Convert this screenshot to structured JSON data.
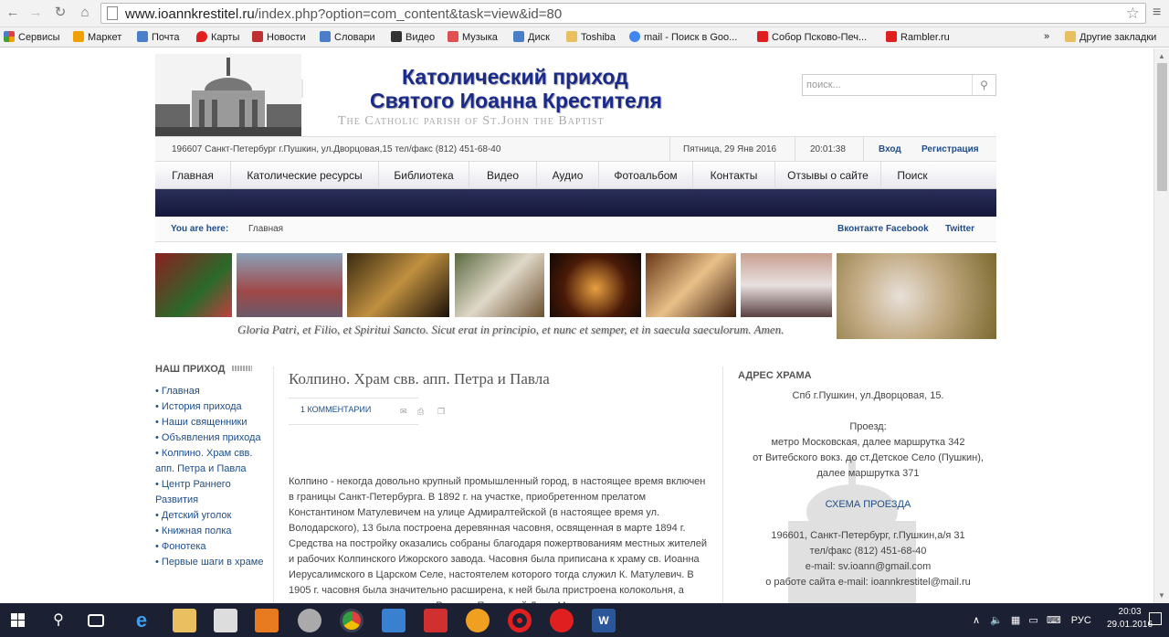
{
  "browser": {
    "url_host": "www.ioannkrestitel.ru",
    "url_path": "/index.php?option=com_content&task=view&id=80"
  },
  "bookmarks": [
    {
      "label": "Сервисы",
      "color": "#e04040"
    },
    {
      "label": "Маркет",
      "color": "#f0a000"
    },
    {
      "label": "Почта",
      "color": "#4a7ec8"
    },
    {
      "label": "Карты",
      "color": "#e02020"
    },
    {
      "label": "Новости",
      "color": "#c03030"
    },
    {
      "label": "Словари",
      "color": "#4a7ec8"
    },
    {
      "label": "Видео",
      "color": "#333333"
    },
    {
      "label": "Музыка",
      "color": "#e05050"
    },
    {
      "label": "Диск",
      "color": "#4a7ec8"
    },
    {
      "label": "Toshiba",
      "color": "#e8c060"
    },
    {
      "label": "mail - Поиск в Goo...",
      "color": "#4285f4"
    },
    {
      "label": "Собор Псково-Печ...",
      "color": "#e02020"
    },
    {
      "label": "Rambler.ru",
      "color": "#e02020"
    }
  ],
  "bookmarks_more": "»",
  "bookmarks_other": "Другие закладки",
  "site": {
    "title_line1": "Католический приход",
    "title_line2": "Святого Иоанна Крестителя",
    "title_en": "The Catholic parish of St.John the Baptist",
    "search_placeholder": "поиск...",
    "address": "196607 Санкт-Петербург г.Пушкин, ул.Дворцовая,15 тел/факс (812) 451-68-40",
    "date": "Пятница, 29 Янв 2016",
    "time": "20:01:38",
    "login": "Вход",
    "register": "Регистрация"
  },
  "nav": [
    "Главная",
    "Католические ресурсы",
    "Библиотека",
    "Видео",
    "Аудио",
    "Фотоальбом",
    "Контакты",
    "Отзывы о сайте",
    "Поиск"
  ],
  "breadcrumb": {
    "you_are_here": "You are here:",
    "current": "Главная",
    "social": "Вконтакте Facebook",
    "twitter": "Twitter"
  },
  "banner_motto": "Gloria Patri, et Filio, et Spiritui Sancto. Sicut erat in principio, et nunc et semper, et in saecula saeculorum. Amen.",
  "left": {
    "heading": "НАШ ПРИХОД",
    "items": [
      "• Главная",
      "• История прихода",
      "• Наши священники",
      "• Объявления прихода",
      "• Колпино. Храм свв. апп. Петра и Павла",
      "• Центр Раннего Развития",
      "• Детский уголок",
      "• Книжная полка",
      "• Фонотека",
      "• Первые шаги в храме"
    ]
  },
  "article": {
    "title": "Колпино. Храм свв. апп. Петра и Павла",
    "comments": "1 КОММЕНТАРИИ",
    "body": "Колпино - некогда довольно крупный промышленный город, в настоящее время включен в границы Санкт-Петербурга. В 1892 г. на участке, приобретенном прелатом Константином Матулевичем на улице Адмиралтейской (в настоящее время ул. Володарского), 13 была построена деревянная часовня, освященная в марте 1894 г. Средства на постройку оказались собраны благодаря пожертвованиям местных жителей и рабочих Колпинского Ижорского завода. Часовня была приписана к храму св. Иоанна Иерусалимского в Царском Селе, настоятелем которого тогда служил К. Матулевич. В 1905 г. часовня была значительно расширена, к ней была пристроена колокольня, а внутри появились два алтаря - Розария Пресвятой Девы Марии и"
  },
  "right": {
    "heading": "АДРЕС ХРАМА",
    "addr": "Спб г.Пушкин, ул.Дворцовая, 15.",
    "proezd": "Проезд:",
    "route1": "метро Московская, далее маршрутка 342",
    "route2": "от Витебского вокз. до ст.Детское Село (Пушкин),",
    "route3": "далее маршрутка 371",
    "scheme": "СХЕМА ПРОЕЗДА",
    "postal": "196601, Санкт-Петербург, г.Пушкин,а/я 31",
    "phone": "тел/факс (812) 451-68-40",
    "email": "e-mail: sv.ioann@gmail.com",
    "webmail": "о работе сайта e-mail: ioannkrestitel@mail.ru"
  },
  "taskbar": {
    "lang": "РУС",
    "time": "20:03",
    "date": "29.01.2016"
  }
}
